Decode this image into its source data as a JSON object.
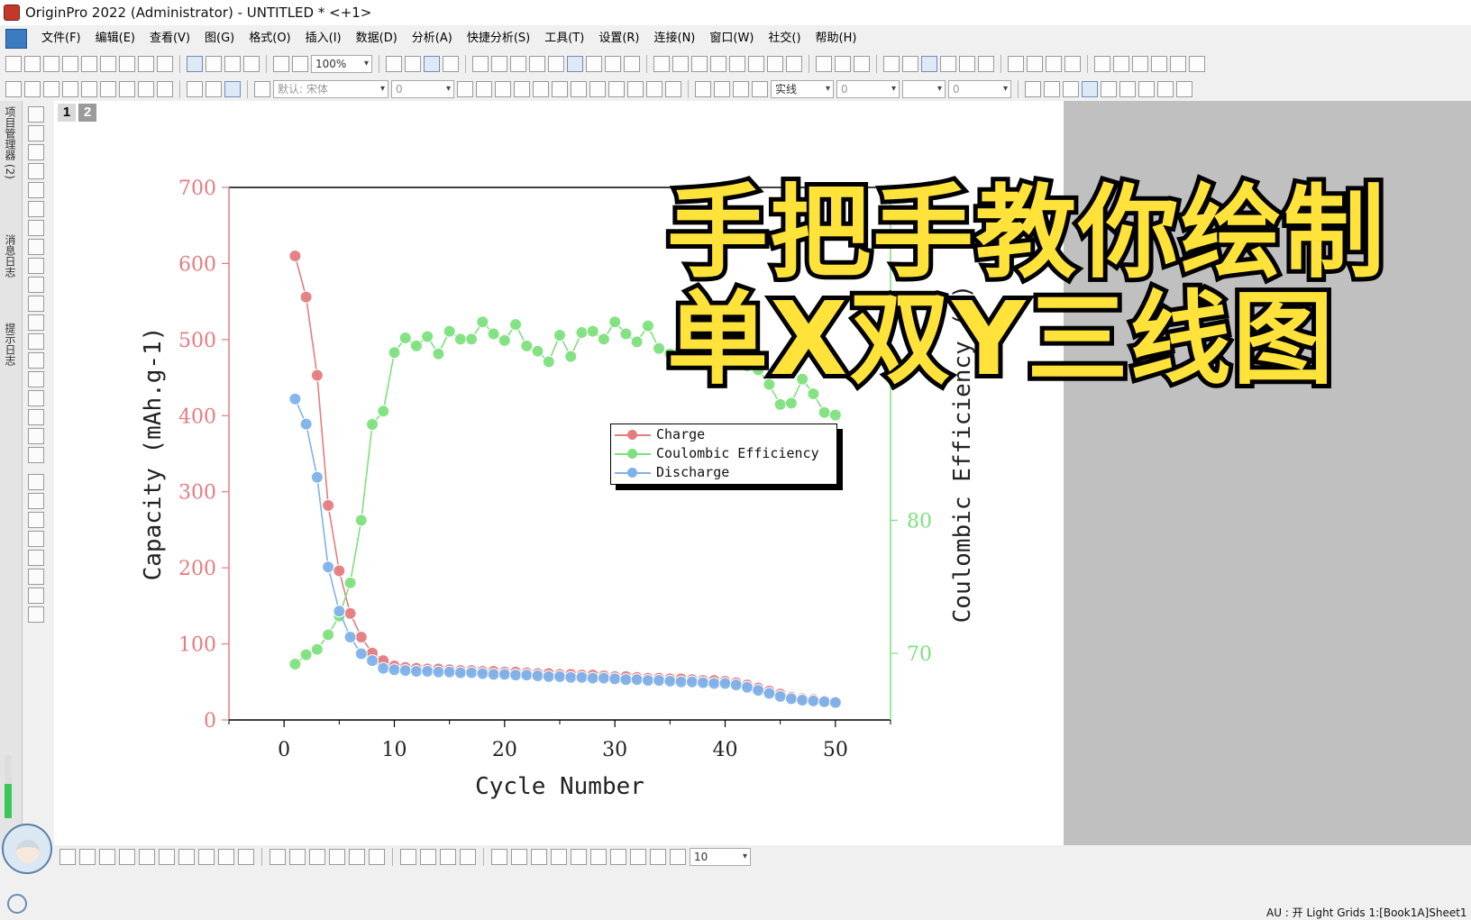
{
  "window": {
    "title": "OriginPro 2022 (Administrator) - UNTITLED * <+1>"
  },
  "menu": [
    "文件(F)",
    "编辑(E)",
    "查看(V)",
    "图(G)",
    "格式(O)",
    "插入(I)",
    "数据(D)",
    "分析(A)",
    "快捷分析(S)",
    "工具(T)",
    "设置(R)",
    "连接(N)",
    "窗口(W)",
    "社交()",
    "帮助(H)"
  ],
  "toolbar": {
    "zoom_value": "100%",
    "font_name": "默认: 宋体",
    "font_size": "0",
    "line_width": "0",
    "line_style": "实线",
    "pattern_value": "0",
    "bottom_value": "10"
  },
  "left_dock": {
    "project_manager": "项目管理器 (2)",
    "message_log": "消息日志",
    "hint_log": "提示日志"
  },
  "graph": {
    "layer_tabs": [
      "1",
      "2"
    ],
    "legend": [
      {
        "label": "Charge",
        "color": "#e57c80"
      },
      {
        "label": "Coulombic Efficiency",
        "color": "#7ee07e"
      },
      {
        "label": "Discharge",
        "color": "#7fb2ea"
      }
    ]
  },
  "chart_data": {
    "type": "line",
    "title": "",
    "xlabel": "Cycle Number",
    "ylabel_left": "Capacity (mAh.g-1)",
    "ylabel_right": "Coulombic Efficiency (%)",
    "xlim": [
      -5,
      55
    ],
    "x_ticks": [
      0,
      10,
      20,
      30,
      40,
      50
    ],
    "ylim_left": [
      0,
      700
    ],
    "y_ticks_left": [
      0,
      100,
      200,
      300,
      400,
      500,
      600,
      700
    ],
    "ylim_right": [
      65,
      105
    ],
    "y_ticks_right": [
      70,
      80
    ],
    "x": [
      1,
      2,
      3,
      4,
      5,
      6,
      7,
      8,
      9,
      10,
      11,
      12,
      13,
      14,
      15,
      16,
      17,
      18,
      19,
      20,
      21,
      22,
      23,
      24,
      25,
      26,
      27,
      28,
      29,
      30,
      31,
      32,
      33,
      34,
      35,
      36,
      37,
      38,
      39,
      40,
      41,
      42,
      43,
      44,
      45,
      46,
      47,
      48,
      49,
      50
    ],
    "series": [
      {
        "name": "Charge",
        "axis": "left",
        "color": "#e57c80",
        "values": [
          610,
          556,
          453,
          282,
          196,
          140,
          109,
          88,
          78,
          71,
          69,
          68,
          67,
          67,
          66,
          65,
          65,
          64,
          64,
          63,
          63,
          62,
          61,
          61,
          60,
          60,
          59,
          59,
          58,
          57,
          57,
          56,
          55,
          55,
          54,
          54,
          53,
          52,
          52,
          51,
          49,
          46,
          42,
          38,
          34,
          30,
          28,
          27,
          25,
          24
        ]
      },
      {
        "name": "Coulombic Efficiency",
        "axis": "right",
        "color": "#7ee07e",
        "values": [
          69.2,
          69.9,
          70.3,
          71.4,
          72.8,
          75.3,
          80.0,
          87.2,
          88.2,
          92.6,
          93.7,
          93.1,
          93.8,
          92.5,
          94.2,
          93.6,
          93.6,
          94.9,
          94.0,
          93.5,
          94.7,
          93.1,
          92.7,
          91.9,
          93.9,
          92.3,
          94.1,
          94.2,
          93.6,
          94.9,
          94.0,
          93.4,
          94.6,
          92.9,
          92.5,
          93.2,
          92.6,
          91.7,
          92.4,
          93.0,
          92.7,
          91.6,
          91.3,
          90.2,
          88.7,
          88.8,
          90.6,
          89.5,
          88.1,
          87.9
        ]
      },
      {
        "name": "Discharge",
        "axis": "left",
        "color": "#7fb2ea",
        "values": [
          422,
          389,
          319,
          201,
          143,
          109,
          87,
          78,
          68,
          66,
          65,
          64,
          64,
          63,
          63,
          62,
          62,
          61,
          60,
          60,
          59,
          59,
          58,
          57,
          57,
          56,
          56,
          55,
          55,
          54,
          53,
          53,
          52,
          52,
          51,
          50,
          50,
          49,
          48,
          48,
          46,
          43,
          39,
          35,
          31,
          28,
          26,
          25,
          24,
          23
        ]
      }
    ]
  },
  "overlay": {
    "line1": "手把手教你绘制",
    "line2": "单X双Y三线图"
  },
  "status": {
    "text": "AU : 开  Light Grids  1:[Book1A]Sheet1"
  }
}
